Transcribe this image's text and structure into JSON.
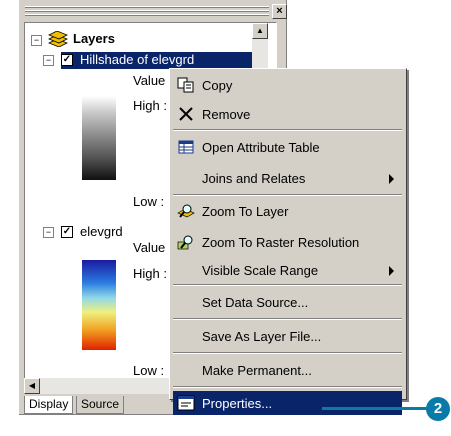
{
  "toc": {
    "root_label": "Layers",
    "layer1": {
      "name": "Hillshade of elevgrd",
      "value_label": "Value",
      "high_label": "High :",
      "low_label": "Low :"
    },
    "layer2": {
      "name": "elevgrd",
      "value_label": "Value",
      "high_label": "High :",
      "low_label": "Low :"
    },
    "tabs": [
      "Display",
      "Source"
    ]
  },
  "menu": {
    "items": [
      {
        "label": "Copy",
        "icon": "copy-icon"
      },
      {
        "label": "Remove",
        "icon": "remove-icon"
      },
      {
        "label": "Open Attribute Table",
        "icon": "table-icon"
      },
      {
        "label": "Joins and Relates",
        "submenu": true
      },
      {
        "label": "Zoom To Layer",
        "icon": "zoom-layer-icon"
      },
      {
        "label": "Zoom To Raster Resolution",
        "icon": "zoom-raster-icon"
      },
      {
        "label": "Visible Scale Range",
        "submenu": true
      },
      {
        "label": "Set Data Source..."
      },
      {
        "label": "Save As Layer File..."
      },
      {
        "label": "Make Permanent..."
      },
      {
        "label": "Properties...",
        "icon": "properties-icon",
        "highlighted": true
      }
    ]
  },
  "callout": {
    "number": "2",
    "color": "#0a7aa8"
  },
  "colors": {
    "selection": "#0a246a",
    "face": "#d4d0c8"
  }
}
